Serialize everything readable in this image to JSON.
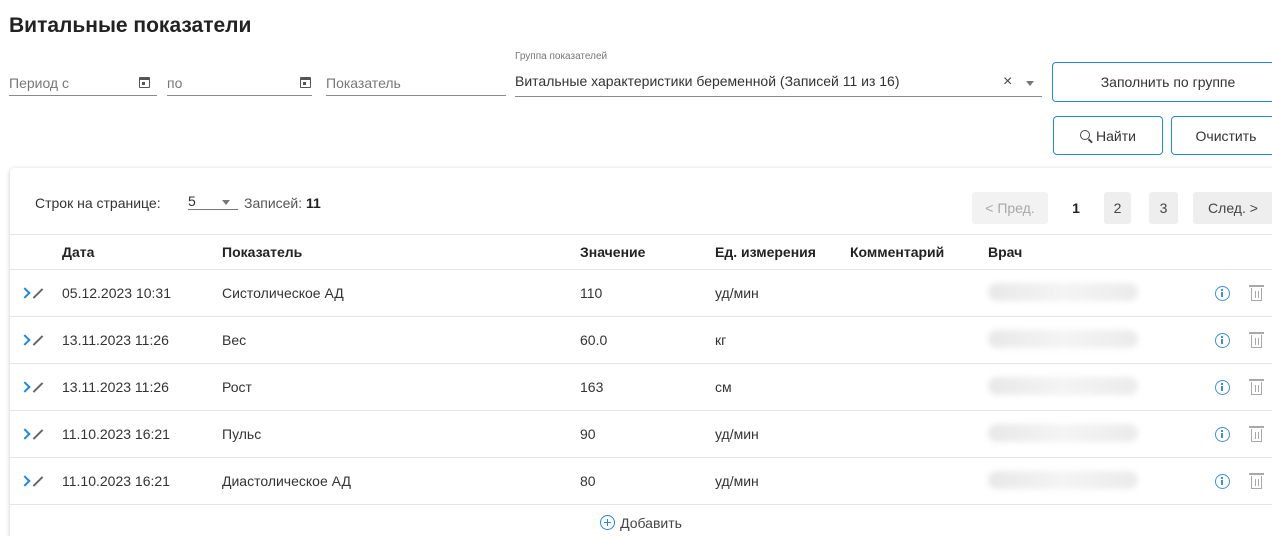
{
  "page": {
    "title": "Витальные показатели"
  },
  "filters": {
    "period_from_placeholder": "Период с",
    "period_to_placeholder": "по",
    "indicator_placeholder": "Показатель",
    "group_label": "Группа показателей",
    "group_value": "Витальные характеристики беременной (Записей 11 из 16)",
    "fill_by_group_label": "Заполнить по группе",
    "find_label": "Найти",
    "clear_label": "Очистить"
  },
  "pager": {
    "rows_per_page_label": "Строк на странице:",
    "rows_per_page_value": "5",
    "records_label": "Записей:",
    "records_count": "11",
    "prev_label": "< Пред.",
    "next_label": "След. >",
    "pages": [
      "1",
      "2",
      "3"
    ],
    "current_page": "1"
  },
  "table": {
    "columns": [
      "Дата",
      "Показатель",
      "Значение",
      "Ед. измерения",
      "Комментарий",
      "Врач"
    ],
    "rows": [
      {
        "date": "05.12.2023 10:31",
        "indicator": "Систолическое АД",
        "value": "110",
        "unit": "уд/мин",
        "comment": ""
      },
      {
        "date": "13.11.2023 11:26",
        "indicator": "Вес",
        "value": "60.0",
        "unit": "кг",
        "comment": ""
      },
      {
        "date": "13.11.2023 11:26",
        "indicator": "Рост",
        "value": "163",
        "unit": "см",
        "comment": ""
      },
      {
        "date": "11.10.2023 16:21",
        "indicator": "Пульс",
        "value": "90",
        "unit": "уд/мин",
        "comment": ""
      },
      {
        "date": "11.10.2023 16:21",
        "indicator": "Диастолическое АД",
        "value": "80",
        "unit": "уд/мин",
        "comment": ""
      }
    ],
    "add_label": "Добавить"
  },
  "icons": {
    "calendar": "calendar-icon",
    "clear": "close-icon",
    "dropdown": "chevron-down-icon",
    "search": "search-icon",
    "expand": "chevron-right-icon",
    "edit": "pencil-icon",
    "info": "info-icon",
    "delete": "trash-icon",
    "add": "plus-circle-icon"
  },
  "colors": {
    "accent": "#1e88e5",
    "text": "#333333",
    "muted": "#777777"
  }
}
